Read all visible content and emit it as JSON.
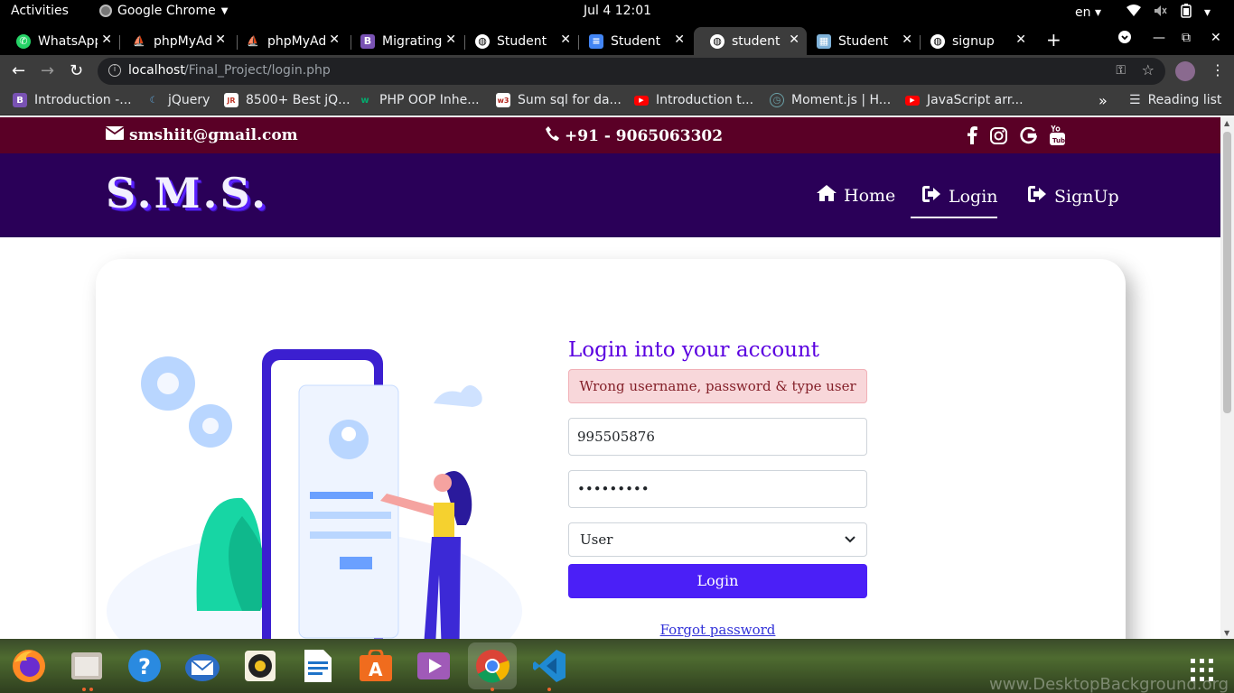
{
  "system_bar": {
    "activities": "Activities",
    "app_name": "Google Chrome",
    "clock": "Jul 4  12:01",
    "locale": "en"
  },
  "tabs": [
    {
      "title": "WhatsApp",
      "icon": "whatsapp-icon",
      "color": "#25d366"
    },
    {
      "title": "phpMyAdmin",
      "icon": "phpmyadmin-icon",
      "color": "#f89c0e"
    },
    {
      "title": "phpMyAdmin",
      "icon": "phpmyadmin-icon",
      "color": "#f89c0e"
    },
    {
      "title": "Migrating",
      "icon": "bootstrap-icon",
      "color": "#7952b3"
    },
    {
      "title": "Student",
      "icon": "globe-icon",
      "color": "#ffffff"
    },
    {
      "title": "Student",
      "icon": "docs-icon",
      "color": "#4285f4"
    },
    {
      "title": "student",
      "icon": "globe-icon",
      "color": "#ffffff"
    },
    {
      "title": "Student",
      "icon": "image-icon",
      "color": "#7fb2d9"
    },
    {
      "title": "signup",
      "icon": "globe-icon",
      "color": "#ffffff"
    }
  ],
  "address_bar": {
    "host": "localhost",
    "path": "/Final_Project/login.php"
  },
  "bookmarks": [
    {
      "label": "Introduction -...",
      "icon": "bootstrap-icon",
      "color": "#7952b3"
    },
    {
      "label": "jQuery",
      "icon": "jquery-icon",
      "color": "#0769ad"
    },
    {
      "label": "8500+ Best jQ...",
      "icon": "jr-icon",
      "color": "#c0392b"
    },
    {
      "label": "PHP OOP Inhe...",
      "icon": "w3schools-icon",
      "color": "#04aa6d"
    },
    {
      "label": "Sum sql for da...",
      "icon": "w3r-icon",
      "color": "#b3261e"
    },
    {
      "label": "Introduction t...",
      "icon": "youtube-icon",
      "color": "#ff0000"
    },
    {
      "label": "Moment.js | H...",
      "icon": "moment-icon",
      "color": "#6ba1a8"
    },
    {
      "label": "JavaScript arr...",
      "icon": "youtube-icon",
      "color": "#ff0000"
    }
  ],
  "bookmarks_more": "»",
  "reading_list": "Reading list",
  "site": {
    "email": "smshiit@gmail.com",
    "phone": "+91 - 9065063302",
    "socials": [
      "facebook-icon",
      "instagram-icon",
      "google-icon",
      "youtube-icon"
    ],
    "brand": "S.M.S.",
    "nav": [
      {
        "label": "Home",
        "icon": "home-icon"
      },
      {
        "label": "Login",
        "icon": "sign-in-icon"
      },
      {
        "label": "SignUp",
        "icon": "sign-in-icon"
      }
    ],
    "colors": {
      "top_strip": "#5a0026",
      "navbar": "#2a0058",
      "accent": "#4b1ff7"
    }
  },
  "login_form": {
    "title": "Login into your account",
    "alert": "Wrong username, password & type user",
    "username_value": "995505876",
    "password_value": "•••••••••",
    "type_selected": "User",
    "login_button": "Login",
    "forgot_link": "Forgot password"
  },
  "dock": {
    "apps": [
      "firefox-icon",
      "files-icon",
      "help-icon",
      "mail-icon",
      "rhythmbox-icon",
      "writer-icon",
      "software-icon",
      "video-icon",
      "chrome-icon",
      "vscode-icon"
    ],
    "watermark": "www.DesktopBackground.org"
  }
}
